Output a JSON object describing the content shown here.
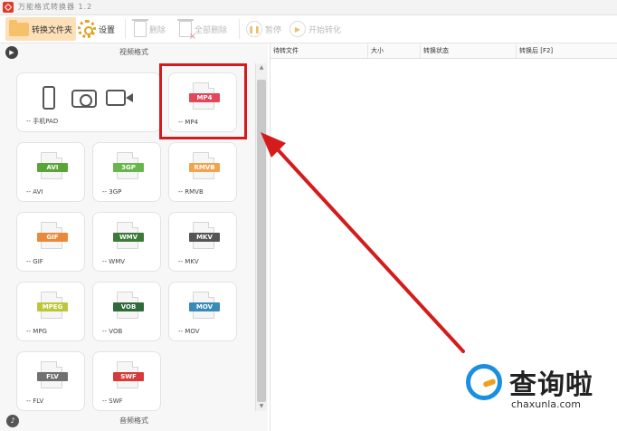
{
  "window": {
    "title": "万能格式转换器 1.2"
  },
  "toolbar": {
    "folder_label": "转换文件夹",
    "settings_label": "设置",
    "delete_label": "删除",
    "delete_all_label": "全部删除",
    "pause_label": "暂停",
    "start_label": "开始转化"
  },
  "left": {
    "video_section": "视频格式",
    "audio_section": "音频格式",
    "cards": [
      {
        "label": "-- 手机PAD"
      },
      {
        "badge": "MP4",
        "label": "-- MP4",
        "color": "#e5475a"
      },
      {
        "badge": "AVI",
        "label": "-- AVI",
        "color": "#5aa53a"
      },
      {
        "badge": "3GP",
        "label": "-- 3GP",
        "color": "#67b64b"
      },
      {
        "badge": "RMVB",
        "label": "-- RMVB",
        "color": "#f3a34b"
      },
      {
        "badge": "GIF",
        "label": "-- GIF",
        "color": "#e98a3a"
      },
      {
        "badge": "WMV",
        "label": "-- WMV",
        "color": "#3d7a3a"
      },
      {
        "badge": "MKV",
        "label": "-- MKV",
        "color": "#555555"
      },
      {
        "badge": "MPEG",
        "label": "-- MPG",
        "color": "#bcc83a"
      },
      {
        "badge": "VOB",
        "label": "-- VOB",
        "color": "#2f6a3a"
      },
      {
        "badge": "MOV",
        "label": "-- MOV",
        "color": "#3a8ab8"
      },
      {
        "badge": "FLV",
        "label": "-- FLV",
        "color": "#707070"
      },
      {
        "badge": "SWF",
        "label": "-- SWF",
        "color": "#d83a3a"
      }
    ]
  },
  "table": {
    "columns": [
      "待转文件",
      "大小",
      "转换状态",
      "转换后 [F2]"
    ]
  },
  "watermark": {
    "text": "查询啦",
    "url": "chaxunla.com"
  },
  "colors": {
    "highlight": "#d41c1c",
    "accent_folder": "#fde0b8"
  }
}
